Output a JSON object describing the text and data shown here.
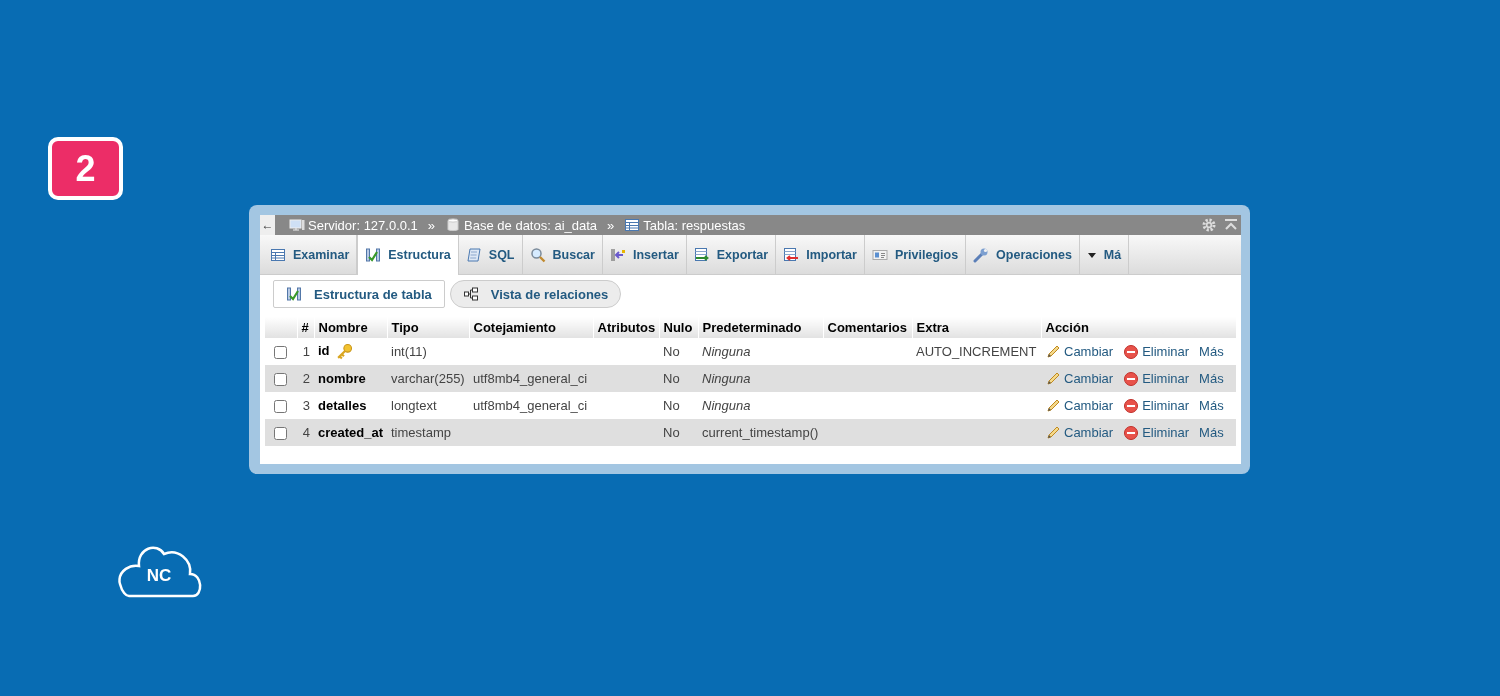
{
  "step_badge": "2",
  "breadcrumb": {
    "back": "←",
    "crumbs": [
      {
        "kind": "link",
        "label": "Servidor: 127.0.0.1"
      },
      {
        "kind": "separator",
        "label": "»"
      },
      {
        "kind": "link",
        "label": "Base de datos: ai_data"
      },
      {
        "kind": "separator",
        "label": "»"
      },
      {
        "kind": "link",
        "label": "Tabla: respuestas"
      }
    ]
  },
  "tabs": [
    {
      "label": "Examinar",
      "selected": false
    },
    {
      "label": "Estructura",
      "selected": true
    },
    {
      "label": "SQL",
      "selected": false
    },
    {
      "label": "Buscar",
      "selected": false
    },
    {
      "label": "Insertar",
      "selected": false
    },
    {
      "label": "Exportar",
      "selected": false
    },
    {
      "label": "Importar",
      "selected": false
    },
    {
      "label": "Privilegios",
      "selected": false
    },
    {
      "label": "Operaciones",
      "selected": false
    },
    {
      "label": "Má",
      "selected": false
    }
  ],
  "subtabs": [
    {
      "label": "Estructura de tabla",
      "selected": true
    },
    {
      "label": "Vista de relaciones",
      "selected": false
    }
  ],
  "table": {
    "columns": [
      "#",
      "Nombre",
      "Tipo",
      "Cotejamiento",
      "Atributos",
      "Nulo",
      "Predeterminado",
      "Comentarios",
      "Extra",
      "Acción"
    ],
    "rows": [
      {
        "checked": false,
        "number": "1",
        "name": "id",
        "primary_key": true,
        "type": "int(11)",
        "collation": "",
        "null": "No",
        "default": "Ninguna",
        "default_italic": true,
        "extra": "AUTO_INCREMENT",
        "actions": [
          "Cambiar",
          "Eliminar",
          "Más"
        ]
      },
      {
        "checked": false,
        "number": "2",
        "name": "nombre",
        "primary_key": false,
        "type": "varchar(255)",
        "collation": "utf8mb4_general_ci",
        "null": "No",
        "default": "Ninguna",
        "default_italic": true,
        "extra": "",
        "actions": [
          "Cambiar",
          "Eliminar",
          "Más"
        ]
      },
      {
        "checked": false,
        "number": "3",
        "name": "detalles",
        "primary_key": false,
        "type": "longtext",
        "collation": "utf8mb4_general_ci",
        "null": "No",
        "default": "Ninguna",
        "default_italic": true,
        "extra": "",
        "actions": [
          "Cambiar",
          "Eliminar",
          "Más"
        ]
      },
      {
        "checked": false,
        "number": "4",
        "name": "created_at",
        "primary_key": false,
        "type": "timestamp",
        "collation": "",
        "null": "No",
        "default": "current_timestamp()",
        "default_italic": false,
        "extra": "",
        "actions": [
          "Cambiar",
          "Eliminar",
          "Más"
        ]
      }
    ]
  },
  "logo": {
    "text": "NC"
  }
}
